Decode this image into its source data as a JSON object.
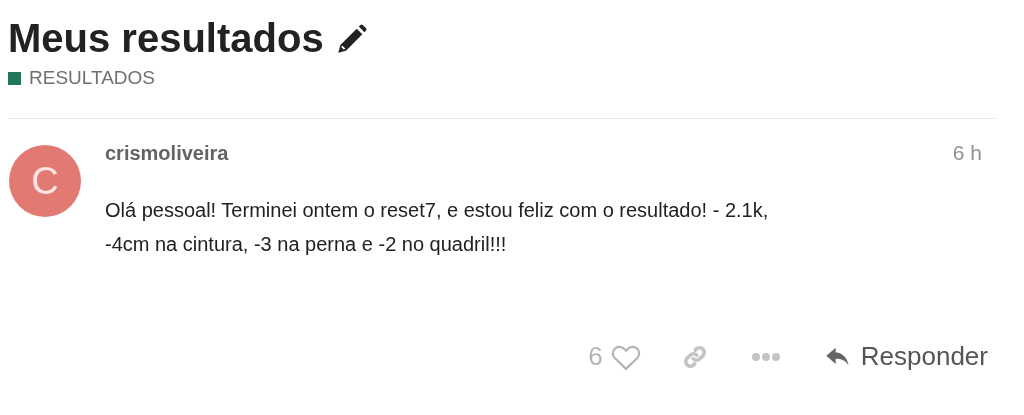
{
  "topic": {
    "title": "Meus resultados",
    "category": {
      "name": "RESULTADOS",
      "color": "#23775a"
    }
  },
  "post": {
    "avatar_letter": "C",
    "username": "crismoliveira",
    "time": "6 h",
    "body": "Olá pessoal! Terminei ontem o reset7, e estou feliz com o resultado! - 2.1k, -4cm na cintura, -3 na perna e -2 no quadril!!!",
    "like_count": "6",
    "liked": false,
    "reply_label": "Responder"
  }
}
